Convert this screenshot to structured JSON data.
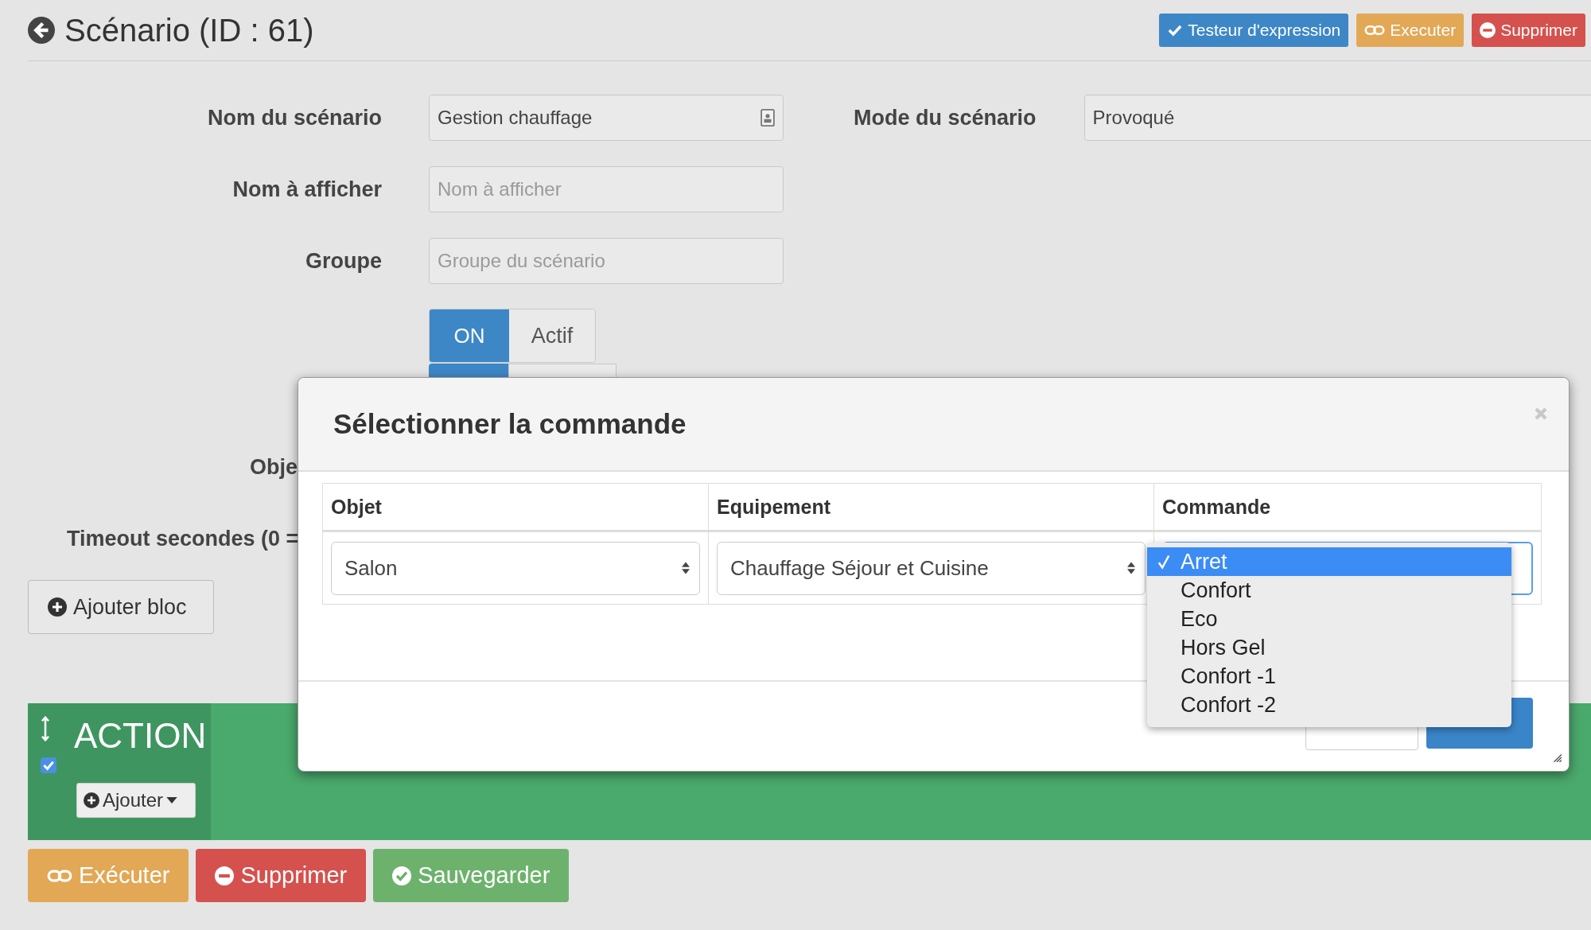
{
  "header": {
    "title": "Scénario (ID : 61)",
    "buttons": [
      {
        "label": "Testeur d'expression",
        "kind": "info"
      },
      {
        "label": "Executer",
        "kind": "warning"
      },
      {
        "label": "Supprimer",
        "kind": "danger"
      }
    ]
  },
  "form": {
    "name": {
      "label": "Nom du scénario",
      "value": "Gestion chauffage"
    },
    "display_name": {
      "label": "Nom à afficher",
      "placeholder": "Nom à afficher"
    },
    "group": {
      "label": "Groupe",
      "placeholder": "Groupe du scénario"
    },
    "mode": {
      "label": "Mode du scénario",
      "value": "Provoqué"
    },
    "active_toggle": {
      "on_label": "ON",
      "label": "Actif",
      "on": true
    },
    "second_toggle": {
      "on": true
    },
    "object_label": "Obje",
    "timeout_label": "Timeout secondes (0 ="
  },
  "add_block_button": "Ajouter bloc",
  "action_block": {
    "title": "ACTION",
    "checked": true,
    "add_button": "Ajouter"
  },
  "footer_buttons": [
    {
      "label": "Exécuter",
      "kind": "warning"
    },
    {
      "label": "Supprimer",
      "kind": "danger"
    },
    {
      "label": "Sauvegarder",
      "kind": "success"
    }
  ],
  "dialog": {
    "title": "Sélectionner la commande",
    "columns": [
      "Objet",
      "Equipement",
      "Commande"
    ],
    "object_value": "Salon",
    "equipment_value": "Chauffage Séjour et Cuisine",
    "command_options": [
      {
        "label": "Arret",
        "selected": true
      },
      {
        "label": "Confort",
        "selected": false
      },
      {
        "label": "Eco",
        "selected": false
      },
      {
        "label": "Hors Gel",
        "selected": false
      },
      {
        "label": "Confort -1",
        "selected": false
      },
      {
        "label": "Confort -2",
        "selected": false
      }
    ]
  }
}
